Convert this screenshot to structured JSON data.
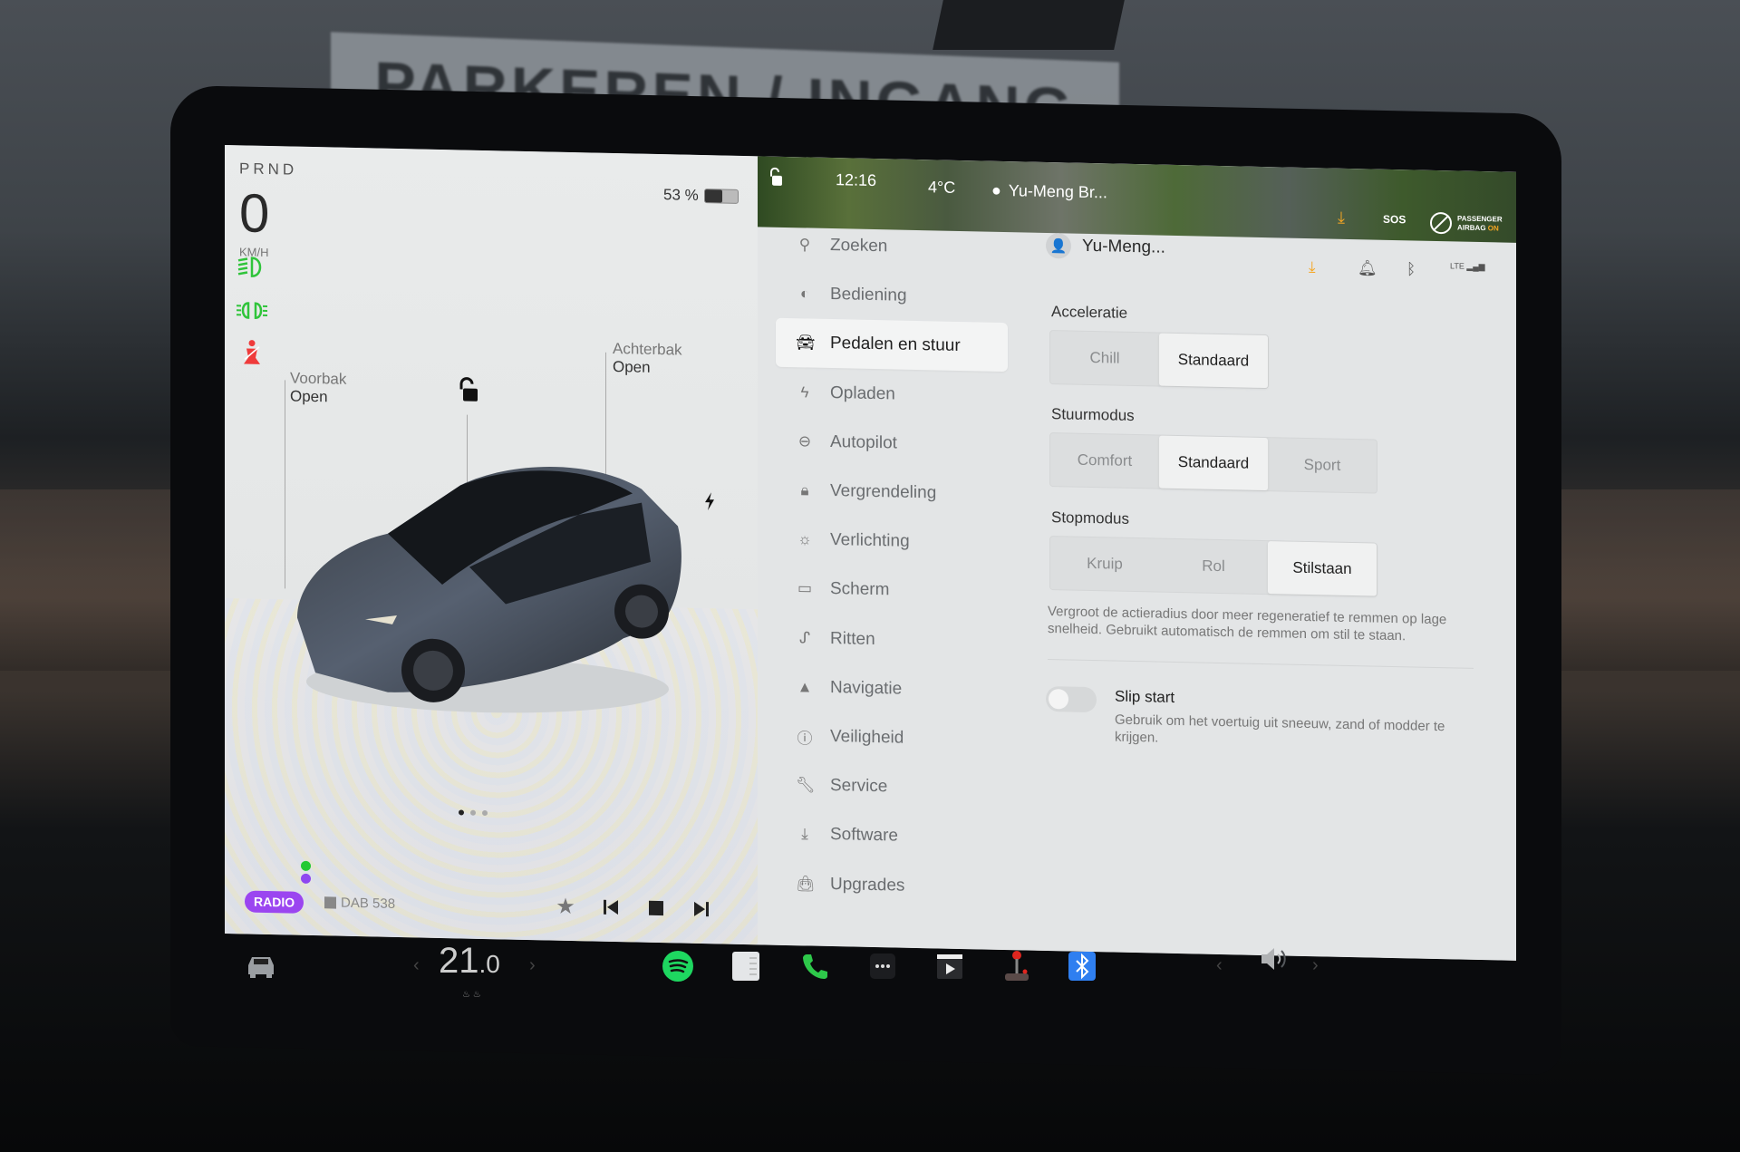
{
  "background": {
    "sign_text": "PARKEREN / INGANG"
  },
  "left_panel": {
    "gear": "PRND",
    "speed": "0",
    "speed_unit": "KM/H",
    "battery_percent_label": "53 %",
    "battery_level": 0.53,
    "telltales": [
      "low-beam-headlight-icon",
      "parking-lights-icon",
      "seatbelt-warning-icon"
    ],
    "frunk": {
      "title": "Voorbak",
      "state": "Open"
    },
    "trunk": {
      "title": "Achterbak",
      "state": "Open"
    },
    "lock_state": "unlocked",
    "page_dots": {
      "count": 3,
      "active": 0
    },
    "media": {
      "source_badge": "RADIO",
      "station": "DAB 538",
      "controls": [
        "favorite-star",
        "previous-track",
        "stop",
        "next-track"
      ]
    }
  },
  "status_bar": {
    "time": "12:16",
    "temperature": "4°C",
    "user": "Yu-Meng Br...",
    "sos": "SOS",
    "airbag_line1": "PASSENGER",
    "airbag_line2": "AIRBAG",
    "airbag_state": "ON"
  },
  "menu": {
    "items": [
      {
        "label": "Zoeken",
        "icon": "search-icon"
      },
      {
        "label": "Bediening",
        "icon": "toggle-icon"
      },
      {
        "label": "Pedalen en stuur",
        "icon": "car-icon",
        "active": true
      },
      {
        "label": "Opladen",
        "icon": "bolt-icon"
      },
      {
        "label": "Autopilot",
        "icon": "steering-wheel-icon"
      },
      {
        "label": "Vergrendeling",
        "icon": "lock-icon"
      },
      {
        "label": "Verlichting",
        "icon": "light-icon"
      },
      {
        "label": "Scherm",
        "icon": "display-icon"
      },
      {
        "label": "Ritten",
        "icon": "trips-icon"
      },
      {
        "label": "Navigatie",
        "icon": "navigation-icon"
      },
      {
        "label": "Veiligheid",
        "icon": "alert-circle-icon"
      },
      {
        "label": "Service",
        "icon": "wrench-icon"
      },
      {
        "label": "Software",
        "icon": "download-icon"
      },
      {
        "label": "Upgrades",
        "icon": "shopping-bag-icon"
      }
    ]
  },
  "content": {
    "profile_name": "Yu-Meng...",
    "status_icons": [
      "download-icon",
      "bell-icon",
      "bluetooth-icon",
      "lte-signal-icon"
    ],
    "lte_label": "LTE",
    "acceleratie": {
      "label": "Acceleratie",
      "options": [
        "Chill",
        "Standaard"
      ],
      "selected": "Standaard"
    },
    "stuurmodus": {
      "label": "Stuurmodus",
      "options": [
        "Comfort",
        "Standaard",
        "Sport"
      ],
      "selected": "Standaard"
    },
    "stopmodus": {
      "label": "Stopmodus",
      "options": [
        "Kruip",
        "Rol",
        "Stilstaan"
      ],
      "selected": "Stilstaan",
      "description": "Vergroot de actieradius door meer regeneratief te remmen op lage snelheid. Gebruikt automatisch de remmen om stil te staan."
    },
    "slip_start": {
      "label": "Slip start",
      "enabled": false,
      "description": "Gebruik om het voertuig uit sneeuw, zand of modder te krijgen."
    }
  },
  "dock": {
    "temperature_main": "21",
    "temperature_decimal": ".0",
    "apps": [
      "car-icon",
      "spotify-icon",
      "calendar-icon",
      "phone-icon",
      "more-icon",
      "theater-icon",
      "arcade-joystick-icon",
      "bluetooth-icon"
    ],
    "volume_icon": "speaker-icon",
    "colors": {
      "spotify": "#1ed760",
      "phone": "#2ec84a",
      "bluetooth": "#2f7ff0",
      "radio": "#9b45f0",
      "warning": "#f5a623"
    }
  }
}
